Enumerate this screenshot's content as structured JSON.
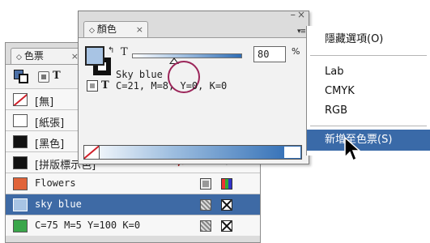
{
  "swatches_panel": {
    "tab_label": "色票",
    "close_glyph": "×",
    "rows": [
      {
        "name": "[無]",
        "chip": "none",
        "icon_right": [
          "icon-cmyk",
          "icon-xbox"
        ]
      },
      {
        "name": "[紙張]",
        "chip": "#ffffff",
        "icon_right": []
      },
      {
        "name": "[黑色]",
        "chip": "#111111",
        "icon_right": [
          "icon-xbox",
          "icon-proc"
        ]
      },
      {
        "name": "[拼版標示色]",
        "chip": "#111111",
        "icon_right": [
          "icon-reg",
          "icon-target"
        ]
      },
      {
        "name": "Flowers",
        "chip": "#e0643a",
        "icon_right": [
          "icon-proc",
          "icon-bars"
        ]
      },
      {
        "name": "sky blue",
        "chip": "#a8c4e4",
        "icon_right": [
          "icon-cmyk",
          "icon-xbox"
        ],
        "selected": true
      },
      {
        "name": "C=75 M=5 Y=100 K=0",
        "chip": "#3aa64a",
        "icon_right": [
          "icon-cmyk",
          "icon-xbox"
        ]
      }
    ],
    "toolbar_t": "T"
  },
  "color_panel": {
    "tab_label": "顏色",
    "close_glyph": "×",
    "minimize_glyph": "–",
    "window_close_glyph": "×",
    "menu_glyph": "▾≡",
    "tint_label": "T",
    "stroke_t_label": "T",
    "tint_value": "80",
    "tint_percent_fraction": 0.8,
    "percent_sign": "%",
    "swatch_name": "Sky blue",
    "cmyk_readout": "C=21, M=8, Y=0, K=0",
    "colors": {
      "fill": "#a8c4e4",
      "ramp_end": "#2f6db5",
      "highlight_ring": "#9b2559"
    }
  },
  "flyout_menu": {
    "items": [
      {
        "label": "隱藏選項(O)"
      },
      {
        "label": "Lab"
      },
      {
        "label": "CMYK"
      },
      {
        "label": "RGB"
      },
      {
        "label": "新增至色票(S)",
        "highlighted": true
      }
    ],
    "highlight_color": "#3a6aa8"
  }
}
